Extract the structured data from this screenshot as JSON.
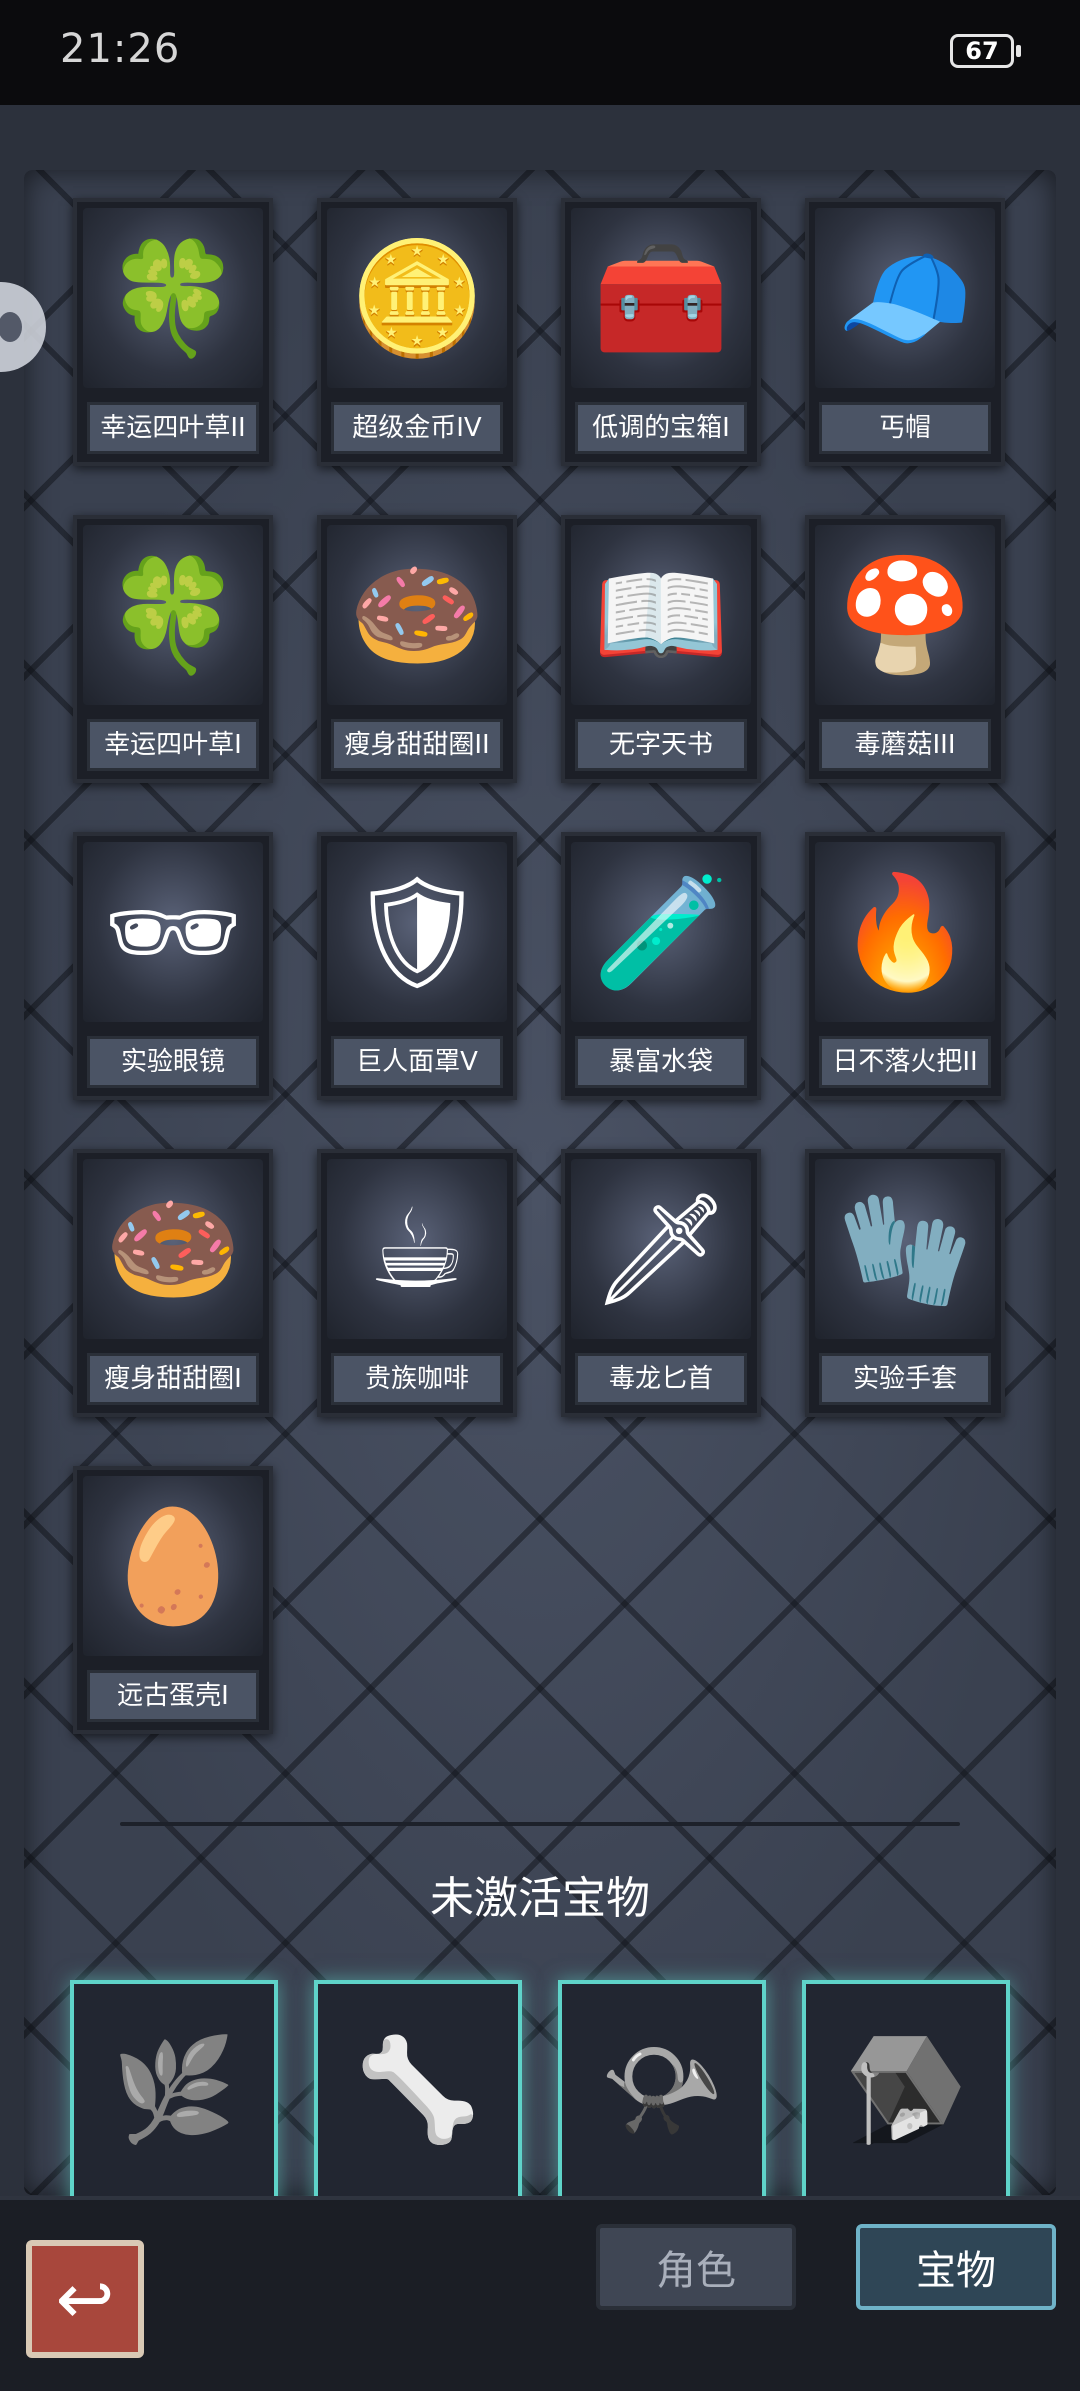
{
  "status_bar": {
    "time": "21:26",
    "battery": "67"
  },
  "active_treasures": [
    {
      "label": "幸运四叶草II",
      "icon": "clover-icon",
      "glyph": "🍀"
    },
    {
      "label": "超级金币IV",
      "icon": "gold-coin-icon",
      "glyph": "🪙"
    },
    {
      "label": "低调的宝箱I",
      "icon": "treasure-chest-icon",
      "glyph": "🧰"
    },
    {
      "label": "丐帽",
      "icon": "beanie-hat-icon",
      "glyph": "🧢"
    },
    {
      "label": "幸运四叶草I",
      "icon": "clover-icon",
      "glyph": "🍀"
    },
    {
      "label": "瘦身甜甜圈II",
      "icon": "donut-icon",
      "glyph": "🍩"
    },
    {
      "label": "无字天书",
      "icon": "open-book-icon",
      "glyph": "📖"
    },
    {
      "label": "毒蘑菇III",
      "icon": "mushroom-icon",
      "glyph": "🍄"
    },
    {
      "label": "实验眼镜",
      "icon": "goggles-icon",
      "glyph": "🕶"
    },
    {
      "label": "巨人面罩V",
      "icon": "mask-icon",
      "glyph": "🛡"
    },
    {
      "label": "暴富水袋",
      "icon": "potion-flask-icon",
      "glyph": "🧪"
    },
    {
      "label": "日不落火把II",
      "icon": "torch-icon",
      "glyph": "🔥"
    },
    {
      "label": "瘦身甜甜圈I",
      "icon": "donut-icon",
      "glyph": "🍩"
    },
    {
      "label": "贵族咖啡",
      "icon": "coffee-cup-icon",
      "glyph": "☕"
    },
    {
      "label": "毒龙匕首",
      "icon": "dagger-icon",
      "glyph": "🗡"
    },
    {
      "label": "实验手套",
      "icon": "glove-icon",
      "glyph": "🧤"
    },
    {
      "label": "远古蛋壳I",
      "icon": "eggshell-icon",
      "glyph": "🥚"
    }
  ],
  "inactive_section": {
    "title": "未激活宝物"
  },
  "inactive_treasures": [
    {
      "icon": "thorny-vine-icon",
      "glyph": "🌿"
    },
    {
      "icon": "bone-club-icon",
      "glyph": "🦴"
    },
    {
      "icon": "horn-icon",
      "glyph": "📯"
    },
    {
      "icon": "bear-trap-icon",
      "glyph": "🪤"
    }
  ],
  "bottom_bar": {
    "back_glyph": "↩",
    "tab_role": "角色",
    "tab_treasure": "宝物"
  }
}
